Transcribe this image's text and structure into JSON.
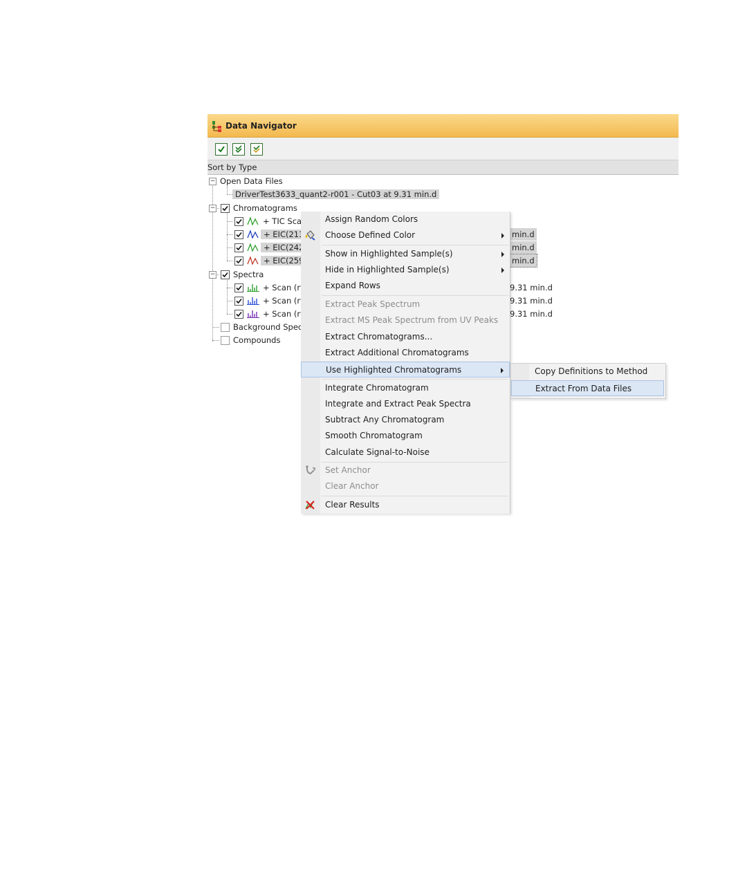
{
  "window": {
    "title": "Data Navigator",
    "sort_label": "Sort by Type",
    "toolbar": [
      "check-all-icon",
      "check-down-icon",
      "check-highlighted-icon"
    ]
  },
  "tree": {
    "open_data_files": {
      "label": "Open Data Files",
      "file": "DriverTest3633_quant2-r001 - Cut03 at 9.31 min.d"
    },
    "chromatograms": {
      "label": "Chromatograms",
      "items": [
        {
          "label": "+ TIC Scan"
        },
        {
          "label": "+ EIC(213.0",
          "suffix": "min.d"
        },
        {
          "label": "+ EIC(242.1",
          "suffix": "min.d"
        },
        {
          "label": "+ EIC(259.0",
          "suffix": "min.d"
        }
      ]
    },
    "spectra": {
      "label": "Spectra",
      "items": [
        {
          "label": "+ Scan (rt:",
          "suffix": "9.31 min.d"
        },
        {
          "label": "+ Scan (rt:",
          "suffix": "9.31 min.d"
        },
        {
          "label": "+ Scan (rt:",
          "suffix": "9.31 min.d"
        }
      ]
    },
    "background_spectra": {
      "label": "Background Spectr"
    },
    "compounds": {
      "label": "Compounds"
    }
  },
  "context_menu": {
    "items": [
      {
        "label": "Assign Random Colors"
      },
      {
        "label": "Choose Defined Color",
        "icon": "paint-bucket-icon"
      },
      {
        "label": "Show in Highlighted Sample(s)"
      },
      {
        "label": "Hide in Highlighted Sample(s)"
      },
      {
        "label": "Expand Rows"
      },
      {
        "label": "Extract Peak Spectrum",
        "disabled": true
      },
      {
        "label": "Extract MS Peak Spectrum from UV Peaks",
        "disabled": true
      },
      {
        "label": "Extract Chromatograms..."
      },
      {
        "label": "Extract Additional Chromatograms"
      },
      {
        "label": "Use Highlighted Chromatograms",
        "highlighted": true
      },
      {
        "label": "Integrate Chromatogram"
      },
      {
        "label": "Integrate and Extract Peak Spectra"
      },
      {
        "label": "Subtract Any Chromatogram"
      },
      {
        "label": "Smooth Chromatogram"
      },
      {
        "label": "Calculate Signal-to-Noise"
      },
      {
        "label": "Set Anchor",
        "disabled": true,
        "icon": "anchor-icon"
      },
      {
        "label": "Clear Anchor",
        "disabled": true
      },
      {
        "label": "Clear Results",
        "icon": "clear-results-icon"
      }
    ]
  },
  "submenu": {
    "items": [
      {
        "label": "Copy Definitions to Method"
      },
      {
        "label": "Extract From Data Files",
        "highlighted": true
      }
    ]
  },
  "colors": {
    "title_gradient_top": "#fbd98c",
    "title_gradient_bottom": "#f3b94f",
    "highlight": "#dce7f5",
    "chromatogram_green": "#2ca02c",
    "chromatogram_blue": "#1f3fbf",
    "chromatogram_red": "#c0392b",
    "spectrum_green": "#2ca02c",
    "spectrum_blue": "#2a4fd4",
    "spectrum_purple": "#7b2fb5"
  }
}
